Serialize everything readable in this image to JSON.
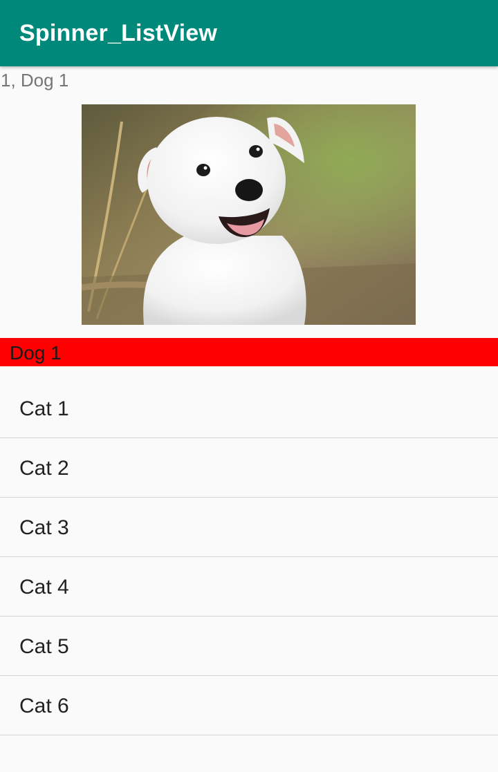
{
  "app_bar": {
    "title": "Spinner_ListView",
    "background": "#00897b"
  },
  "selection_status": "1, Dog 1",
  "photo": {
    "subject": "white-puppy-photo"
  },
  "spinner": {
    "selected_value": "Dog 1",
    "background": "#ff0000"
  },
  "list": {
    "items": [
      {
        "label": "Cat 1"
      },
      {
        "label": "Cat 2"
      },
      {
        "label": "Cat 3"
      },
      {
        "label": "Cat 4"
      },
      {
        "label": "Cat 5"
      },
      {
        "label": "Cat 6"
      }
    ]
  }
}
